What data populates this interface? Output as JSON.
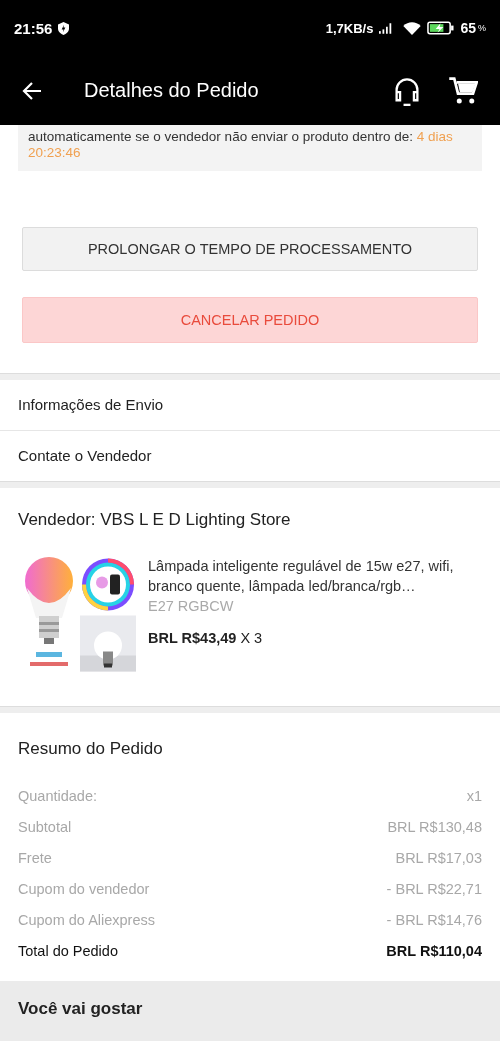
{
  "status_bar": {
    "time": "21:56",
    "speed": "1,7KB/s",
    "battery": "65",
    "battery_unit": "%"
  },
  "header": {
    "title": "Detalhes do Pedido"
  },
  "notice": {
    "text": "automaticamente se o vendedor não enviar o produto dentro de: ",
    "countdown": "4 dias 20:23:46"
  },
  "buttons": [
    {
      "label": "PROLONGAR O TEMPO DE PROCESSAMENTO",
      "kind": "secondary"
    },
    {
      "label": "CANCELAR PEDIDO",
      "kind": "danger"
    }
  ],
  "links": [
    "Informações de Envio",
    "Contate o Vendedor"
  ],
  "seller": {
    "label": "Vendedor: VBS L E D Lighting Store"
  },
  "product": {
    "title": "Lâmpada inteligente regulável de 15w e27, wifi, branco quente, lâmpada led/branca/rgb…",
    "variant": "E27 RGBCW",
    "price": "BRL R$43,49",
    "quantity": "X 3"
  },
  "summary": {
    "title": "Resumo do Pedido",
    "rows": [
      {
        "label": "Quantidade:",
        "value": "x1",
        "kind": "muted"
      },
      {
        "label": "Subtotal",
        "value": "BRL R$130,48",
        "kind": "muted"
      },
      {
        "label": "Frete",
        "value": "BRL R$17,03",
        "kind": "muted"
      },
      {
        "label": "Cupom do vendedor",
        "value": "- BRL R$22,71",
        "kind": "muted"
      },
      {
        "label": "Cupom do Aliexpress",
        "value": "- BRL R$14,76",
        "kind": "muted"
      },
      {
        "label": "Total do Pedido",
        "value": "BRL R$110,04",
        "kind": "total"
      }
    ]
  },
  "recommend": {
    "title": "Você vai gostar"
  }
}
